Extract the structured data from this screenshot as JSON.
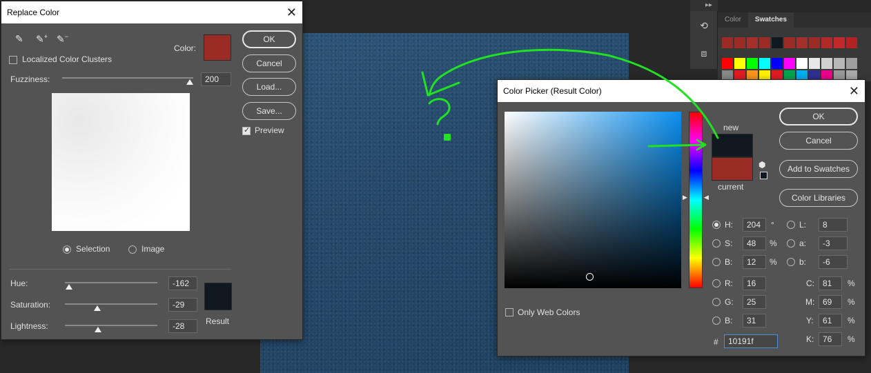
{
  "colors": {
    "selected_swatch": "#9a2b25",
    "result_swatch": "#10191f",
    "new_color": "#10191f",
    "current_color": "#9a2b25"
  },
  "right_panel": {
    "tabs": [
      "Color",
      "Swatches"
    ],
    "collapse_glyph": "▸▸"
  },
  "replace_color": {
    "title": "Replace Color",
    "localized_clusters_label": "Localized Color Clusters",
    "color_label": "Color:",
    "fuzziness_label": "Fuzziness:",
    "fuzziness_value": "200",
    "selection_label": "Selection",
    "image_label": "Image",
    "preview_label": "Preview",
    "buttons": {
      "ok": "OK",
      "cancel": "Cancel",
      "load": "Load...",
      "save": "Save..."
    },
    "hue_label": "Hue:",
    "hue_value": "-162",
    "saturation_label": "Saturation:",
    "saturation_value": "-29",
    "lightness_label": "Lightness:",
    "lightness_value": "-28",
    "result_label": "Result"
  },
  "color_picker": {
    "title": "Color Picker (Result Color)",
    "new_label": "new",
    "current_label": "current",
    "only_web_colors_label": "Only Web Colors",
    "buttons": {
      "ok": "OK",
      "cancel": "Cancel",
      "add_to_swatches": "Add to Swatches",
      "color_libraries": "Color Libraries"
    },
    "fields": {
      "H": {
        "label": "H:",
        "value": "204",
        "unit": "°"
      },
      "S": {
        "label": "S:",
        "value": "48",
        "unit": "%"
      },
      "B": {
        "label": "B:",
        "value": "12",
        "unit": "%"
      },
      "R": {
        "label": "R:",
        "value": "16"
      },
      "G": {
        "label": "G:",
        "value": "25"
      },
      "Bl": {
        "label": "B:",
        "value": "31"
      },
      "L": {
        "label": "L:",
        "value": "8"
      },
      "a": {
        "label": "a:",
        "value": "-3"
      },
      "b": {
        "label": "b:",
        "value": "-6"
      },
      "C": {
        "label": "C:",
        "value": "81",
        "unit": "%"
      },
      "M": {
        "label": "M:",
        "value": "69",
        "unit": "%"
      },
      "Y": {
        "label": "Y:",
        "value": "61",
        "unit": "%"
      },
      "K": {
        "label": "K:",
        "value": "76",
        "unit": "%"
      }
    },
    "hex_label": "#",
    "hex_value": "10191f"
  }
}
